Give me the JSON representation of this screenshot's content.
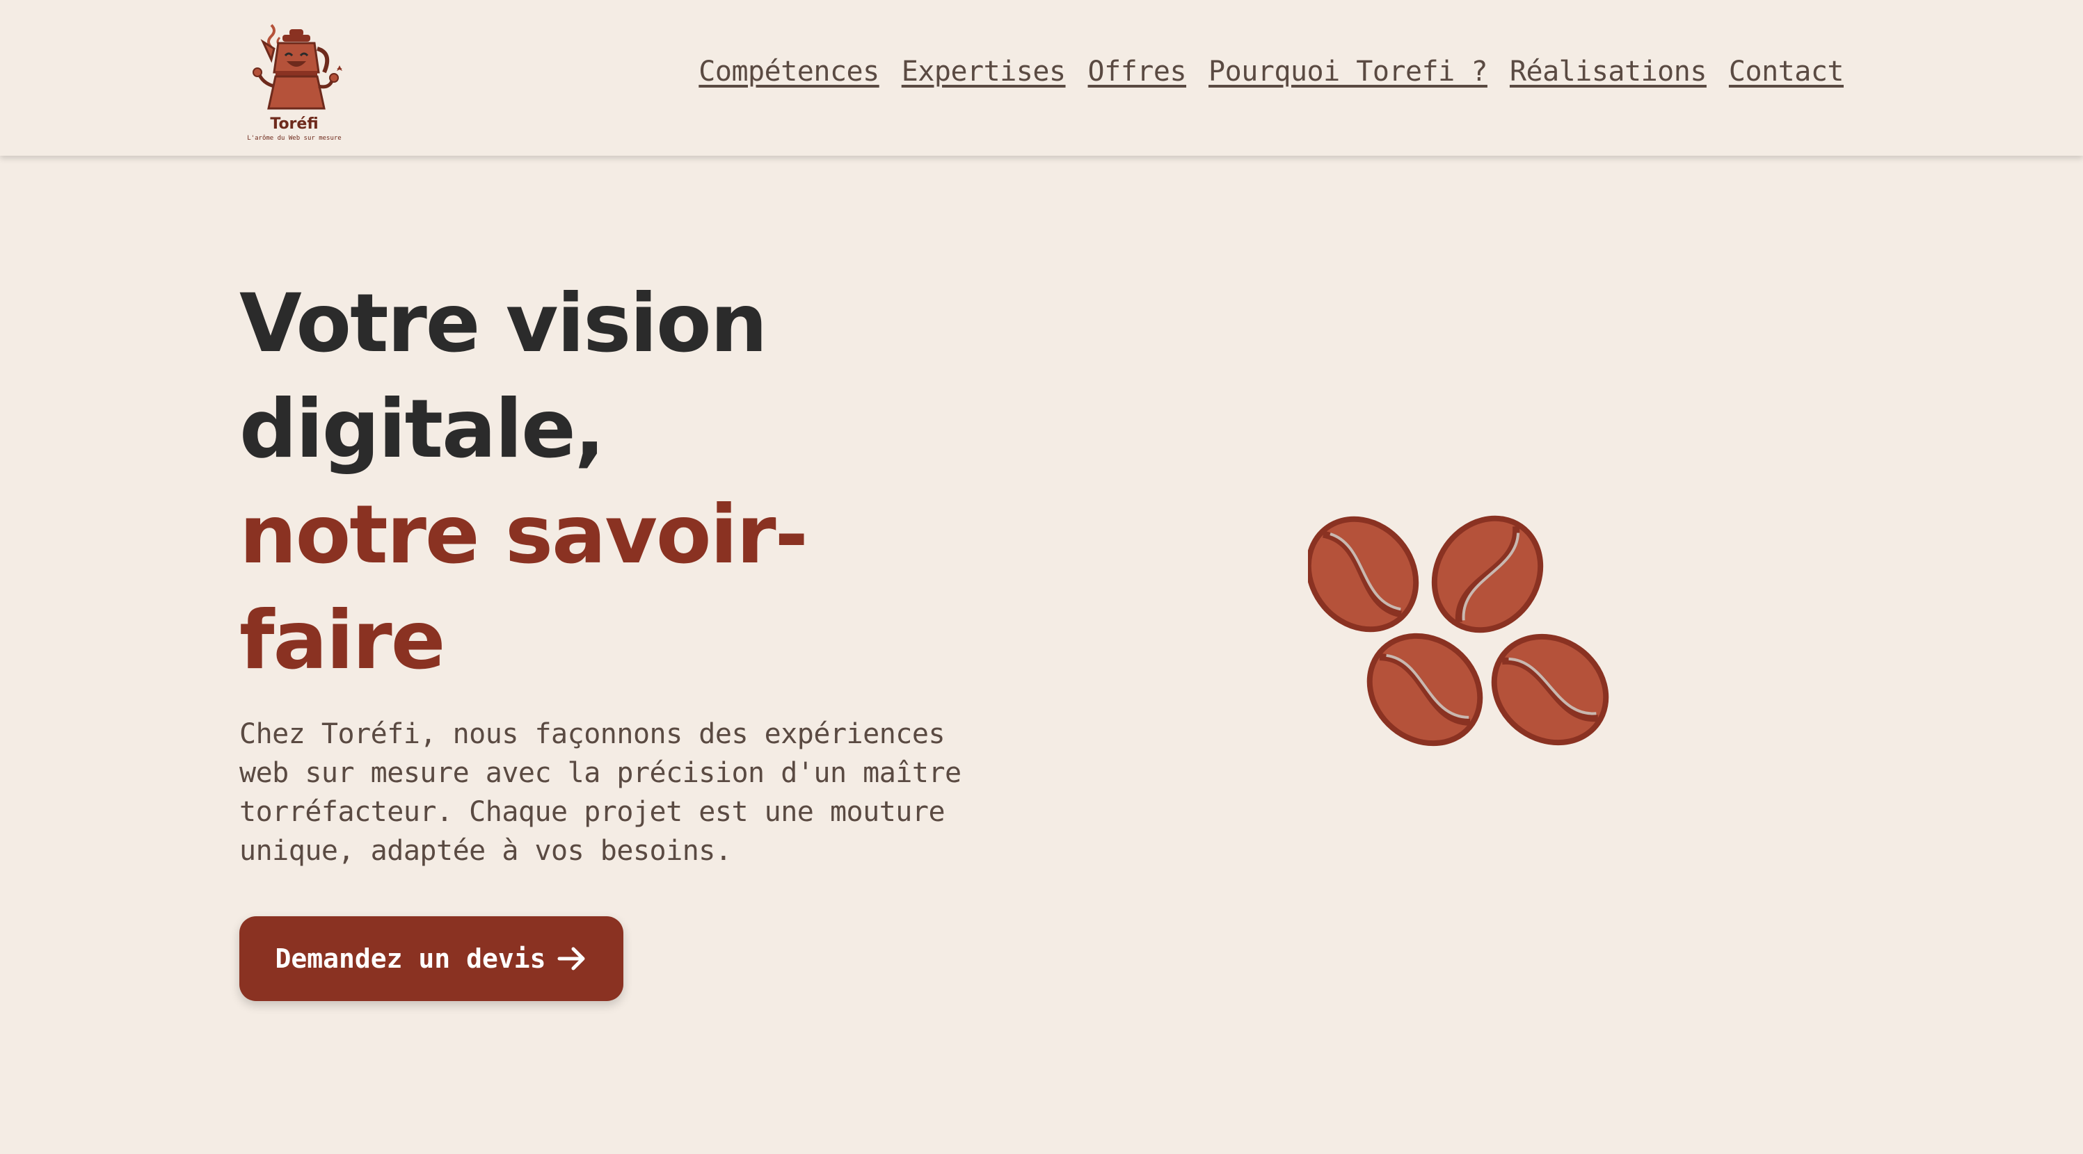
{
  "logo": {
    "name": "Toréfi",
    "tagline": "L'arôme du Web sur mesure"
  },
  "nav": {
    "items": [
      {
        "label": "Compétences"
      },
      {
        "label": "Expertises"
      },
      {
        "label": "Offres"
      },
      {
        "label": "Pourquoi Torefi ?"
      },
      {
        "label": "Réalisations"
      },
      {
        "label": "Contact"
      }
    ]
  },
  "hero": {
    "title_line1": "Votre vision digitale,",
    "title_line2": "notre savoir-faire",
    "description": "Chez Toréfi, nous façonnons des expériences web sur mesure avec la précision d'un maître torréfacteur. Chaque projet est une mouture unique, adaptée à vos besoins.",
    "cta_label": "Demandez un devis",
    "cta_icon": "arrow-right-icon"
  },
  "colors": {
    "background": "#f4ece4",
    "accent": "#8a3222",
    "bean_fill": "#b5523a",
    "bean_outline": "#8a3222",
    "text_dark": "#2b2b2b",
    "text_muted": "#5a4a42"
  }
}
